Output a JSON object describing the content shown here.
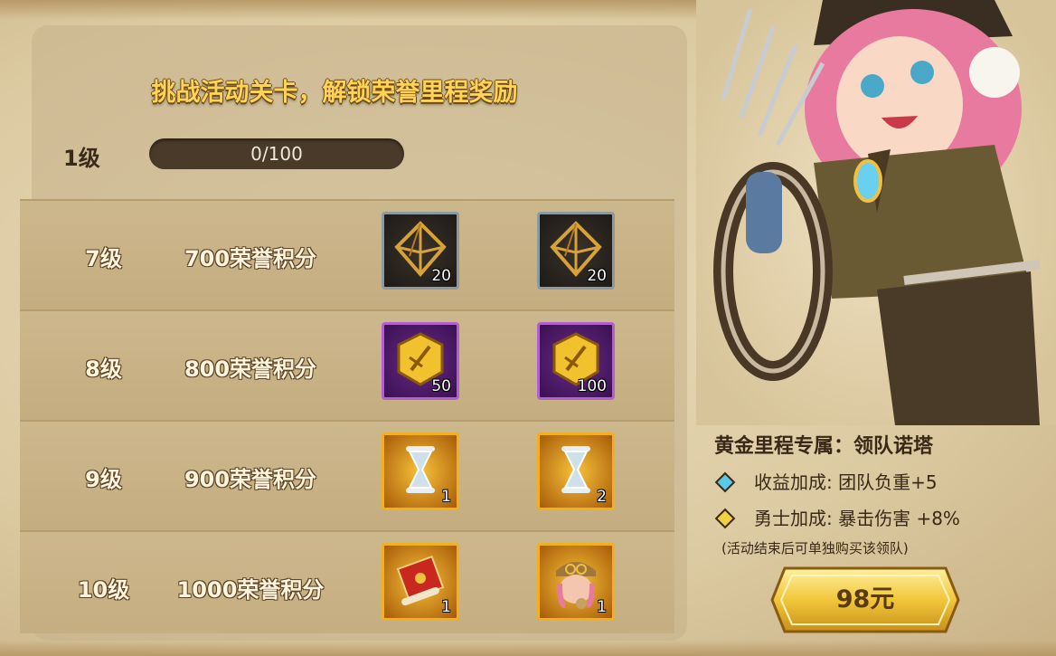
{
  "title": "挑战活动关卡，解锁荣誉里程奖励",
  "progress": {
    "level_label": "1级",
    "text": "0/100",
    "fraction": 0
  },
  "rows": [
    {
      "level": "7级",
      "points": "700荣誉积分",
      "rewards": [
        {
          "icon": "octahedron-frame-icon",
          "quality": "gray",
          "count": "20"
        },
        {
          "icon": "octahedron-frame-icon",
          "quality": "gray",
          "count": "20"
        }
      ]
    },
    {
      "level": "8级",
      "points": "800荣誉积分",
      "rewards": [
        {
          "icon": "gold-sword-coin-icon",
          "quality": "purple",
          "count": "50"
        },
        {
          "icon": "gold-sword-coin-icon",
          "quality": "purple",
          "count": "100"
        }
      ]
    },
    {
      "level": "9级",
      "points": "900荣誉积分",
      "rewards": [
        {
          "icon": "hourglass-icon",
          "quality": "gold",
          "count": "1"
        },
        {
          "icon": "hourglass-icon",
          "quality": "gold",
          "count": "2"
        }
      ]
    },
    {
      "level": "10级",
      "points": "1000荣誉积分",
      "rewards": [
        {
          "icon": "scroll-icon",
          "quality": "gold",
          "count": "1"
        },
        {
          "icon": "leader-portrait-icon",
          "quality": "gold",
          "count": "1"
        }
      ]
    }
  ],
  "info": {
    "title": "黄金里程专属：领队诺塔",
    "bullet1": "收益加成: 团队负重+5",
    "bullet1_color": "#5ac8e8",
    "bullet2": "勇士加成: 暴击伤害 +8%",
    "bullet2_color": "#f0d040",
    "note": "(活动结束后可单独购买该领队)"
  },
  "buy_button": "98元"
}
